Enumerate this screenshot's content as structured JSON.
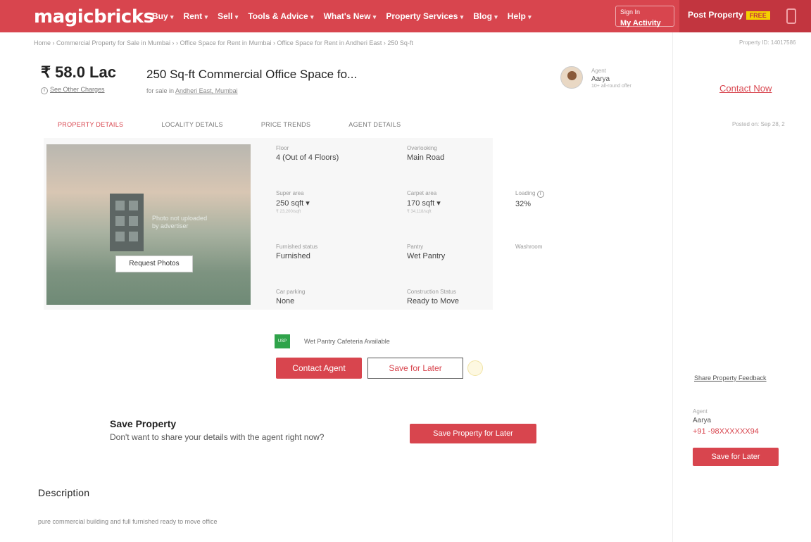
{
  "header": {
    "logo": "magicbricks",
    "nav": [
      {
        "label": "Buy",
        "name": "nav-buy"
      },
      {
        "label": "Rent",
        "name": "nav-rent"
      },
      {
        "label": "Sell",
        "name": "nav-sell"
      },
      {
        "label": "Tools & Advice",
        "name": "nav-tools-advice"
      },
      {
        "label": "What's New",
        "name": "nav-whats-new"
      },
      {
        "label": "Property Services",
        "name": "nav-property-services"
      },
      {
        "label": "Blog",
        "name": "nav-blog"
      },
      {
        "label": "Help",
        "name": "nav-help"
      }
    ],
    "signin_line1": "Sign In",
    "signin_line2": "My Activity",
    "post_property": "Post Property",
    "free_badge": "FREE",
    "accent_color": "#d8454e"
  },
  "breadcrumb": "Home  ›  Commercial Property for Sale in Mumbai  ›  ›  Office Space for Rent in Mumbai  ›  Office Space for Rent in Andheri East  ›  250 Sq-ft",
  "side_top_note": "Property ID: 14017586",
  "listing": {
    "price": "₹ 58.0 Lac",
    "other_charges_link": "See Other Charges",
    "title": "250 Sq-ft Commercial Office Space fo...",
    "subtitle_prefix": "for sale in",
    "subtitle_link": "Andheri East, Mumbai"
  },
  "agent": {
    "label": "Agent",
    "name": "Aarya",
    "extra": "10+ all-round offer"
  },
  "contact_now": "Contact Now",
  "tabs": [
    "PROPERTY DETAILS",
    "LOCALITY DETAILS",
    "PRICE TRENDS",
    "AGENT DETAILS"
  ],
  "posted_on": "Posted on: Sep 28, 2",
  "photo": {
    "caption": "Photo not uploaded by advertiser",
    "request_button": "Request Photos"
  },
  "attributes": {
    "floor": {
      "label": "Floor",
      "value": "4 (Out of 4 Floors)"
    },
    "overlooking": {
      "label": "Overlooking",
      "value": "Main Road"
    },
    "super_area": {
      "label": "Super area",
      "value": "250 sqft ▾",
      "sub": "₹ 23,200/sqft"
    },
    "carpet_area": {
      "label": "Carpet area",
      "value": "170 sqft ▾",
      "sub": "₹ 34,118/sqft"
    },
    "loading": {
      "label": "Loading",
      "value": "32%"
    },
    "furnished": {
      "label": "Furnished status",
      "value": "Furnished"
    },
    "pantry": {
      "label": "Pantry",
      "value": "Wet Pantry"
    },
    "washroom": {
      "label": "Washroom",
      "value": ""
    },
    "car_parking": {
      "label": "Car parking",
      "value": "None"
    },
    "construction": {
      "label": "Construction Status",
      "value": "Ready to Move"
    }
  },
  "usp": {
    "badge": "USP",
    "text": "Wet Pantry Cafeteria Available"
  },
  "buttons": {
    "contact_agent": "Contact Agent",
    "save_for_later": "Save for Later",
    "save_property_for_later": "Save Property for Later",
    "side_save_for_later": "Save for Later"
  },
  "share_feedback": "Share Property Feedback",
  "save_section": {
    "title": "Save Property",
    "desc": "Don't want to share your details with the agent right now?"
  },
  "side_card": {
    "label": "Agent",
    "name": "Aarya",
    "phone": "+91 -98XXXXXX94"
  },
  "description": {
    "title": "Description",
    "text": "pure commercial building and full furnished ready to move office"
  }
}
